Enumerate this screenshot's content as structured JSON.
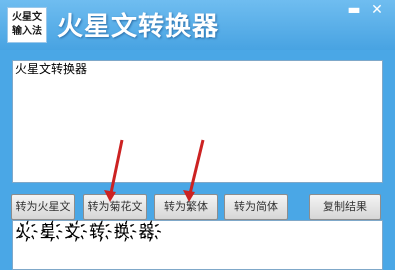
{
  "logo": {
    "line1": "火星文",
    "line2": "输入法"
  },
  "window": {
    "title": "火星文转换器",
    "minimize": "▬",
    "close": "✕"
  },
  "input": {
    "value": "火星文转换器"
  },
  "buttons": {
    "to_martian": "转为火星文",
    "to_flower": "转为菊花文",
    "to_traditional": "转为繁体",
    "to_simplified": "转为简体",
    "copy_result": "复制结果"
  },
  "output": {
    "value": "火҉星҉文҉转҉换҉器҉"
  },
  "annotations": {
    "arrow_color": "#cc2222"
  }
}
